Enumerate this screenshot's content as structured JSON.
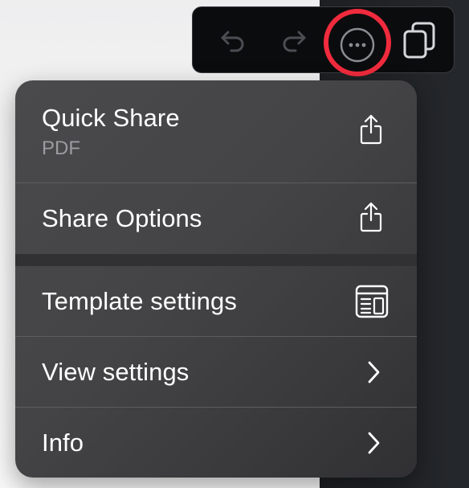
{
  "toolbar": {
    "undo_icon": "undo-arrow-icon",
    "redo_icon": "redo-arrow-icon",
    "more_icon": "ellipsis-circle-icon",
    "copy_icon": "duplicate-pages-icon",
    "highlight_color": "#ef2b3d"
  },
  "menu": {
    "items": [
      {
        "label": "Quick Share",
        "sublabel": "PDF",
        "icon": "share-icon"
      },
      {
        "label": "Share Options",
        "icon": "share-icon"
      },
      {
        "label": "Template settings",
        "icon": "template-layout-icon"
      },
      {
        "label": "View settings",
        "icon": "chevron-right-icon"
      },
      {
        "label": "Info",
        "icon": "chevron-right-icon"
      }
    ]
  },
  "colors": {
    "menu_bg": "#444446",
    "text": "#ffffff",
    "secondary_text": "#9c9ca0",
    "toolbar_bg": "#0b0c0e"
  }
}
